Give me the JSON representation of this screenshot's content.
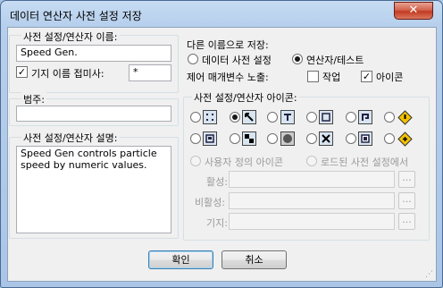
{
  "window": {
    "title": "데이터 연산자 사전 설정 저장",
    "close_label": "✕"
  },
  "name_group": {
    "legend": "사전 설정/연산자 이름:",
    "name_value": "Speed Gen.",
    "prefix_checked": true,
    "prefix_label": "기지 이름 접미사:",
    "prefix_value": "*"
  },
  "category_group": {
    "legend": "범주:",
    "value": ""
  },
  "description_group": {
    "legend": "사전 설정/연산자 설명:",
    "value": "Speed Gen controls particle speed by numeric values."
  },
  "save_as": {
    "label": "다른 이름으로 저장:",
    "options": [
      {
        "label": "데이터 사전 설정",
        "selected": false
      },
      {
        "label": "연산자/테스트",
        "selected": true
      }
    ]
  },
  "expose": {
    "label": "제어 매개변수 노출:",
    "options": [
      {
        "label": "작업",
        "checked": false
      },
      {
        "label": "아이콘",
        "checked": true
      }
    ]
  },
  "icon_group": {
    "legend": "사전 설정/연산자 아이콘:",
    "icons_row1": [
      "grid-dots-icon",
      "arrow-diagonal-icon",
      "pin-icon",
      "frame-icon",
      "bracket-icon",
      "warning-diamond-icon"
    ],
    "icons_row2": [
      "box-icon",
      "checker-icon",
      "sphere-icon",
      "x-box-icon",
      "cube-icon",
      "warning-diamond-plus-icon"
    ],
    "selected_icon": "arrow-diagonal-icon",
    "user_icon_label": "사용자 정의 아이콘",
    "loaded_icon_label": "로드된 사전 설정에서",
    "active_label": "활성:",
    "inactive_label": "비활성:",
    "default_label": "기지:",
    "browse_label": "..."
  },
  "buttons": {
    "ok": "확인",
    "cancel": "취소"
  }
}
